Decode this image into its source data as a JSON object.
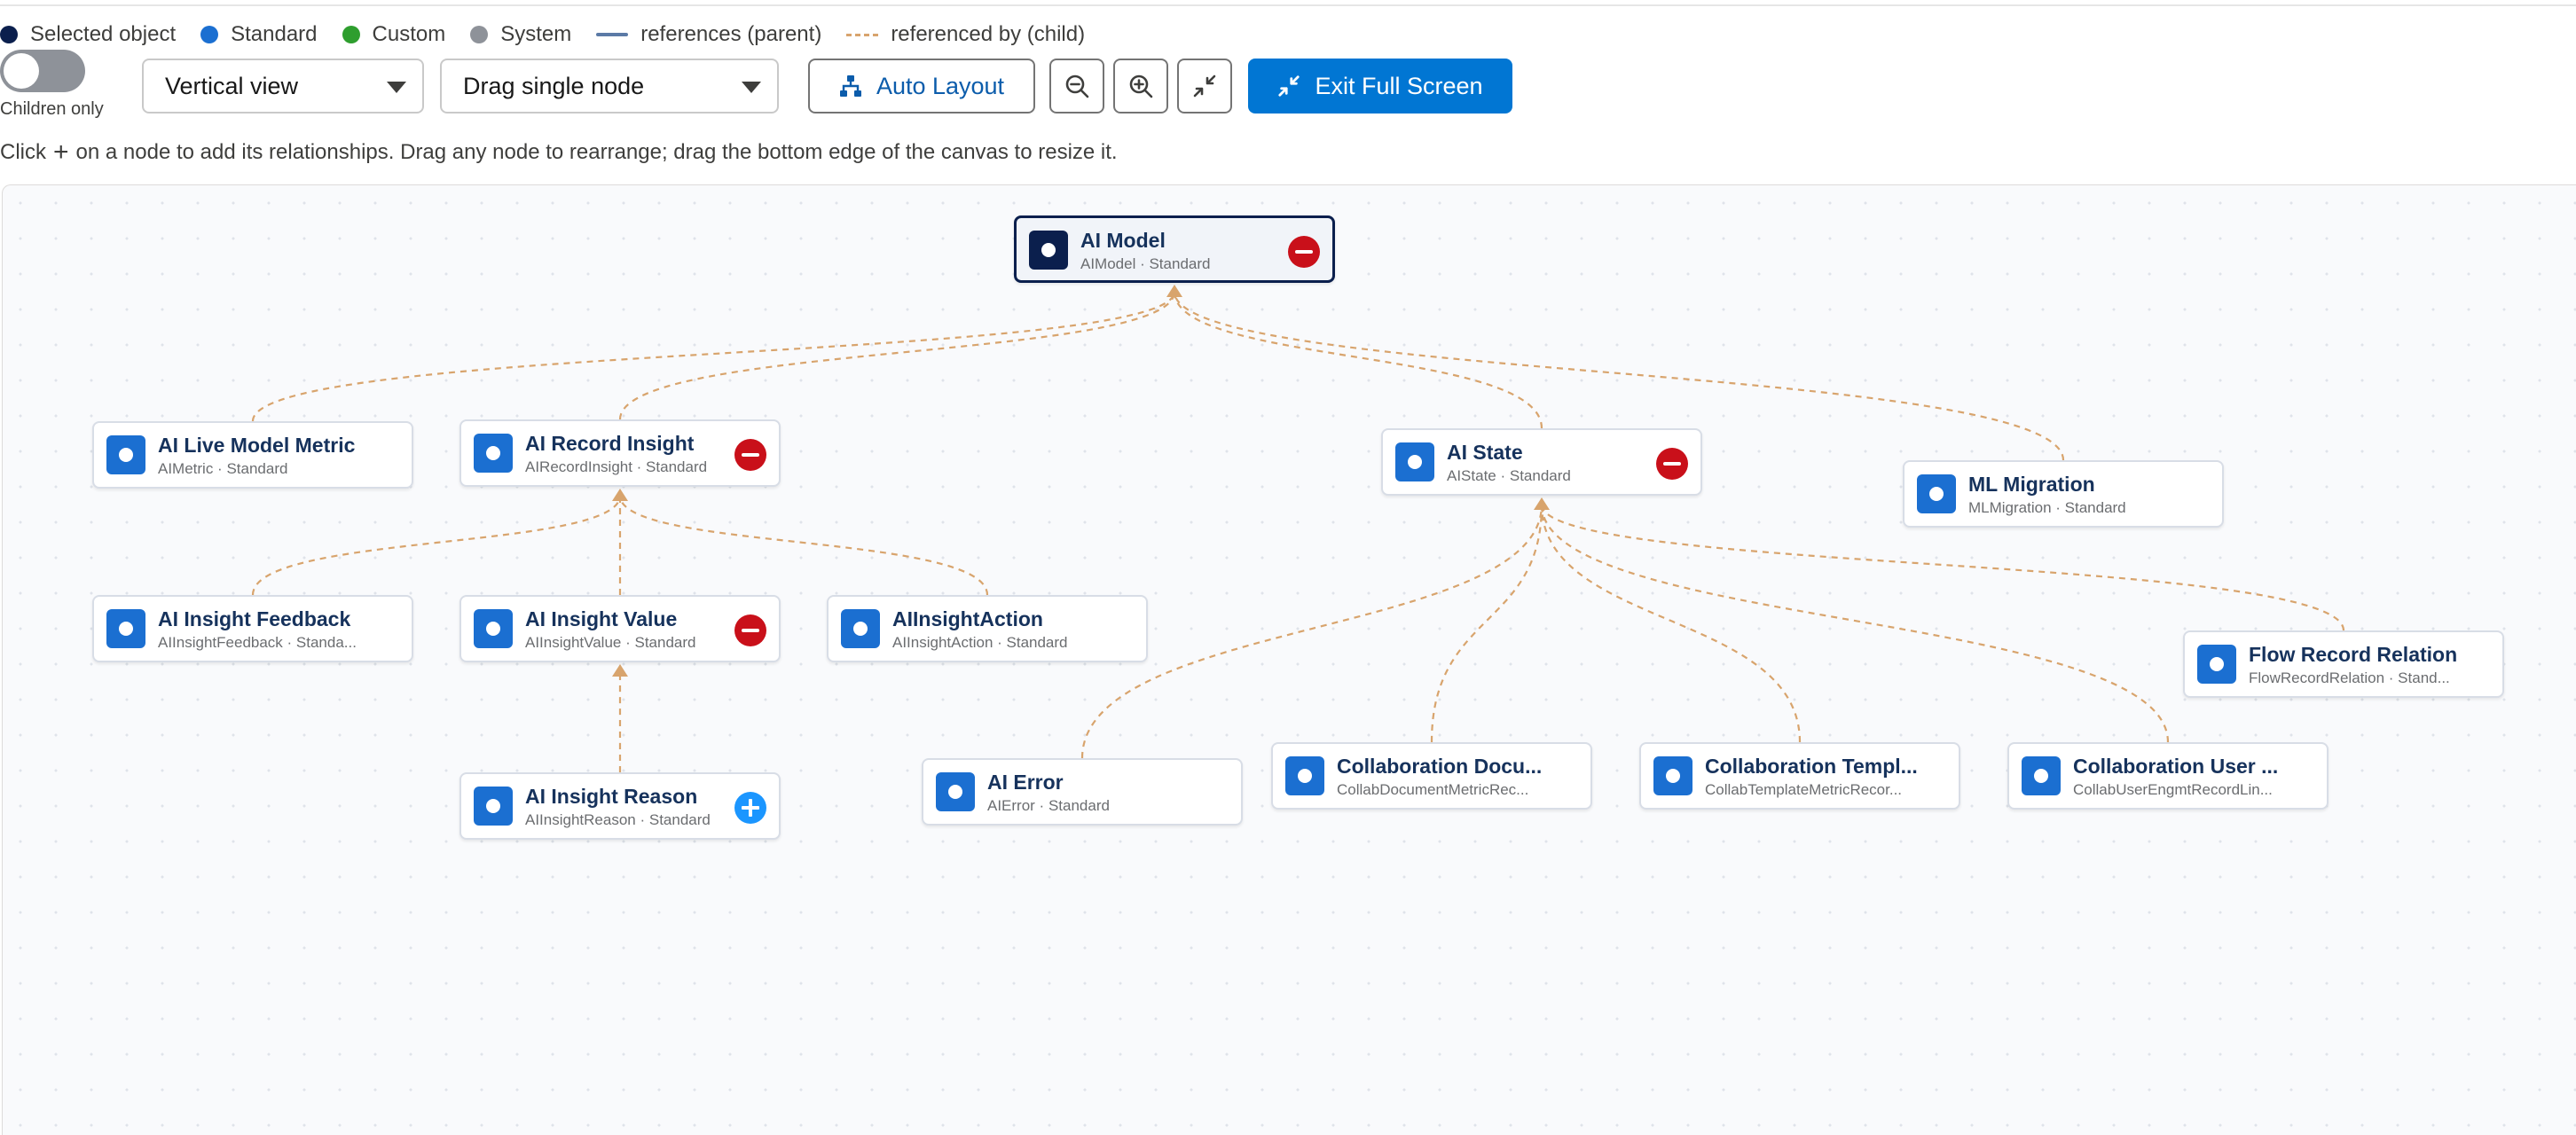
{
  "legend": {
    "selected": "Selected object",
    "standard": "Standard",
    "custom": "Custom",
    "system": "System",
    "references": "references (parent)",
    "referenced_by": "referenced by (child)"
  },
  "colors": {
    "selected": "#0b1f4d",
    "standard": "#1b6fd1",
    "custom": "#2e9e2e",
    "system": "#8e9299",
    "references_line": "#5b7aa6",
    "referenced_by_line": "#d8a46d",
    "brand": "#0176d3",
    "remove": "#c9101a",
    "add": "#1b96ff"
  },
  "toolbar": {
    "children_only_label": "Children only",
    "children_only_on": false,
    "view_select": "Vertical view",
    "drag_select": "Drag single node",
    "auto_layout": "Auto Layout",
    "zoom_out_icon": "zoom-out-icon",
    "zoom_in_icon": "zoom-in-icon",
    "shrink_icon": "shrink-icon",
    "exit_full_screen": "Exit Full Screen"
  },
  "hint": {
    "before": "Click",
    "after": "on a node to add its relationships. Drag any node to rearrange; drag the bottom edge of the canvas to resize it."
  },
  "nodes": [
    {
      "id": "ai_model",
      "title": "AI Model",
      "subtitle": "AIModel · Standard",
      "kind": "selected",
      "action": "remove"
    },
    {
      "id": "ai_live_model_metric",
      "title": "AI Live Model Metric",
      "subtitle": "AIMetric · Standard",
      "kind": "standard",
      "action": ""
    },
    {
      "id": "ai_record_insight",
      "title": "AI Record Insight",
      "subtitle": "AIRecordInsight · Standard",
      "kind": "standard",
      "action": "remove"
    },
    {
      "id": "ai_state",
      "title": "AI State",
      "subtitle": "AIState · Standard",
      "kind": "standard",
      "action": "remove"
    },
    {
      "id": "ml_migration",
      "title": "ML Migration",
      "subtitle": "MLMigration · Standard",
      "kind": "standard",
      "action": ""
    },
    {
      "id": "ai_insight_feedback",
      "title": "AI Insight Feedback",
      "subtitle": "AIInsightFeedback · Standa...",
      "kind": "standard",
      "action": ""
    },
    {
      "id": "ai_insight_value",
      "title": "AI Insight Value",
      "subtitle": "AIInsightValue · Standard",
      "kind": "standard",
      "action": "remove"
    },
    {
      "id": "ai_insight_action",
      "title": "AIInsightAction",
      "subtitle": "AIInsightAction · Standard",
      "kind": "standard",
      "action": ""
    },
    {
      "id": "flow_record_relation",
      "title": "Flow Record Relation",
      "subtitle": "FlowRecordRelation · Stand...",
      "kind": "standard",
      "action": ""
    },
    {
      "id": "ai_insight_reason",
      "title": "AI Insight Reason",
      "subtitle": "AIInsightReason · Standard",
      "kind": "standard",
      "action": "add"
    },
    {
      "id": "ai_error",
      "title": "AI Error",
      "subtitle": "AIError · Standard",
      "kind": "standard",
      "action": ""
    },
    {
      "id": "collab_document",
      "title": "Collaboration Docu...",
      "subtitle": "CollabDocumentMetricRec...",
      "kind": "standard",
      "action": ""
    },
    {
      "id": "collab_template",
      "title": "Collaboration Templ...",
      "subtitle": "CollabTemplateMetricRecor...",
      "kind": "standard",
      "action": ""
    },
    {
      "id": "collab_user",
      "title": "Collaboration User ...",
      "subtitle": "CollabUserEngmtRecordLin...",
      "kind": "standard",
      "action": ""
    }
  ],
  "edges": [
    {
      "child": "ai_live_model_metric",
      "parent": "ai_model",
      "type": "referenced_by"
    },
    {
      "child": "ai_record_insight",
      "parent": "ai_model",
      "type": "referenced_by"
    },
    {
      "child": "ai_state",
      "parent": "ai_model",
      "type": "referenced_by"
    },
    {
      "child": "ml_migration",
      "parent": "ai_model",
      "type": "referenced_by"
    },
    {
      "child": "ai_insight_feedback",
      "parent": "ai_record_insight",
      "type": "referenced_by"
    },
    {
      "child": "ai_insight_value",
      "parent": "ai_record_insight",
      "type": "referenced_by"
    },
    {
      "child": "ai_insight_action",
      "parent": "ai_record_insight",
      "type": "referenced_by"
    },
    {
      "child": "ai_insight_reason",
      "parent": "ai_insight_value",
      "type": "referenced_by"
    },
    {
      "child": "ai_error",
      "parent": "ai_state",
      "type": "referenced_by"
    },
    {
      "child": "collab_document",
      "parent": "ai_state",
      "type": "referenced_by"
    },
    {
      "child": "collab_template",
      "parent": "ai_state",
      "type": "referenced_by"
    },
    {
      "child": "collab_user",
      "parent": "ai_state",
      "type": "referenced_by"
    },
    {
      "child": "flow_record_relation",
      "parent": "ai_state",
      "type": "referenced_by"
    }
  ]
}
